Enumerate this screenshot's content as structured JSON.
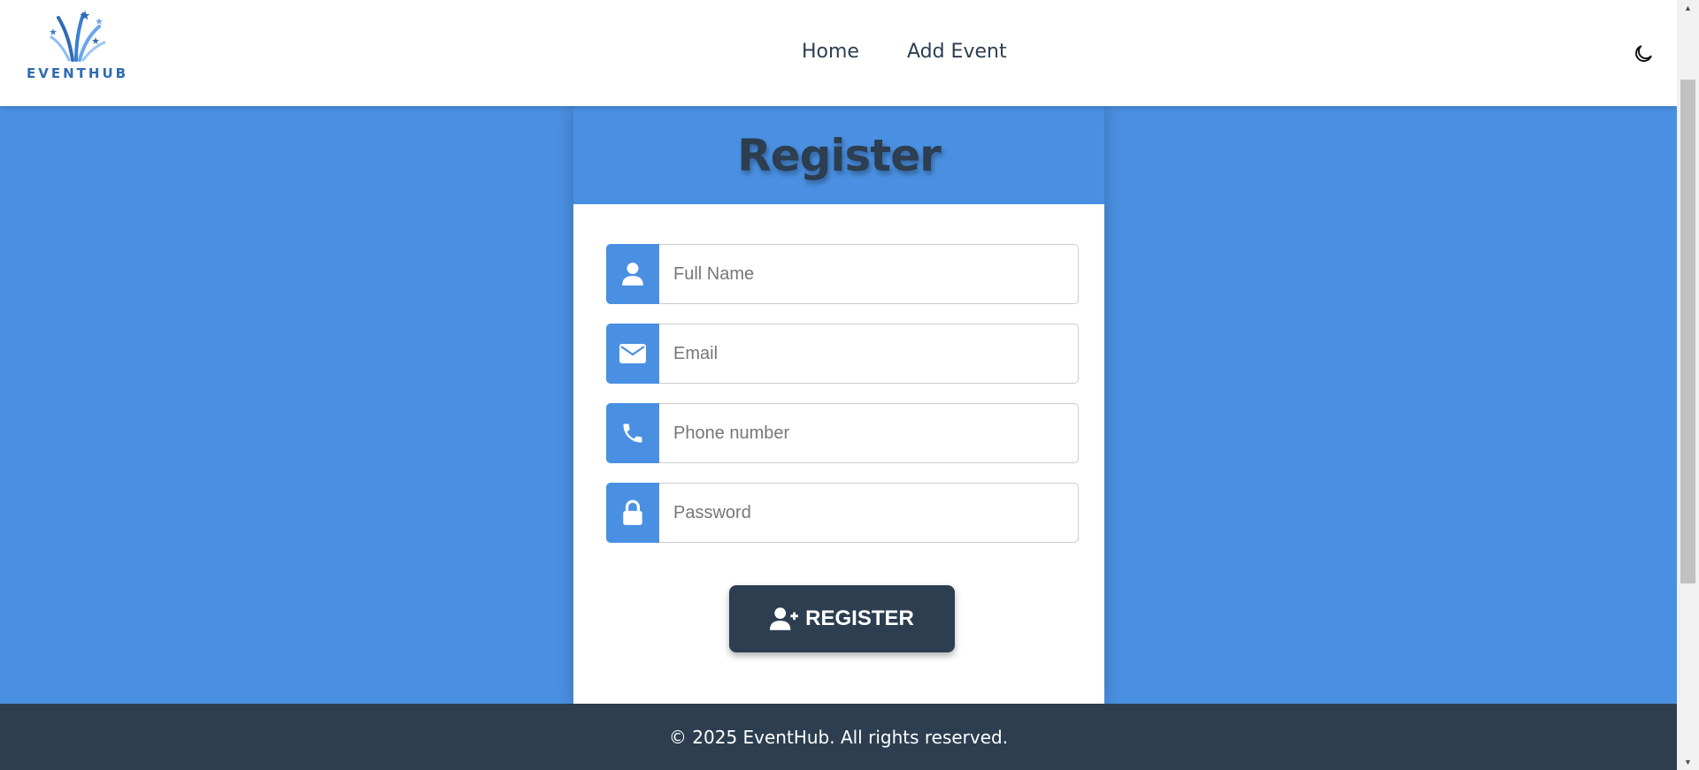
{
  "brand": {
    "name": "EVENTHUB",
    "logo_icon": "fireworks-stars-logo"
  },
  "nav": {
    "items": [
      {
        "label": "Home"
      },
      {
        "label": "Add Event"
      }
    ],
    "theme_toggle_icon": "moon-icon"
  },
  "register": {
    "title": "Register",
    "fields": [
      {
        "placeholder": "Full Name",
        "icon": "user-icon"
      },
      {
        "placeholder": "Email",
        "icon": "envelope-icon"
      },
      {
        "placeholder": "Phone number",
        "icon": "phone-icon"
      },
      {
        "placeholder": "Password",
        "icon": "lock-icon"
      }
    ],
    "button_label": "REGISTER",
    "button_icon": "user-plus-icon"
  },
  "footer": {
    "text": "© 2025 EventHub. All rights reserved."
  },
  "colors": {
    "page_background": "#4a90e2",
    "header_background": "#ffffff",
    "dark": "#2c3e50",
    "accent": "#4a90e2"
  }
}
